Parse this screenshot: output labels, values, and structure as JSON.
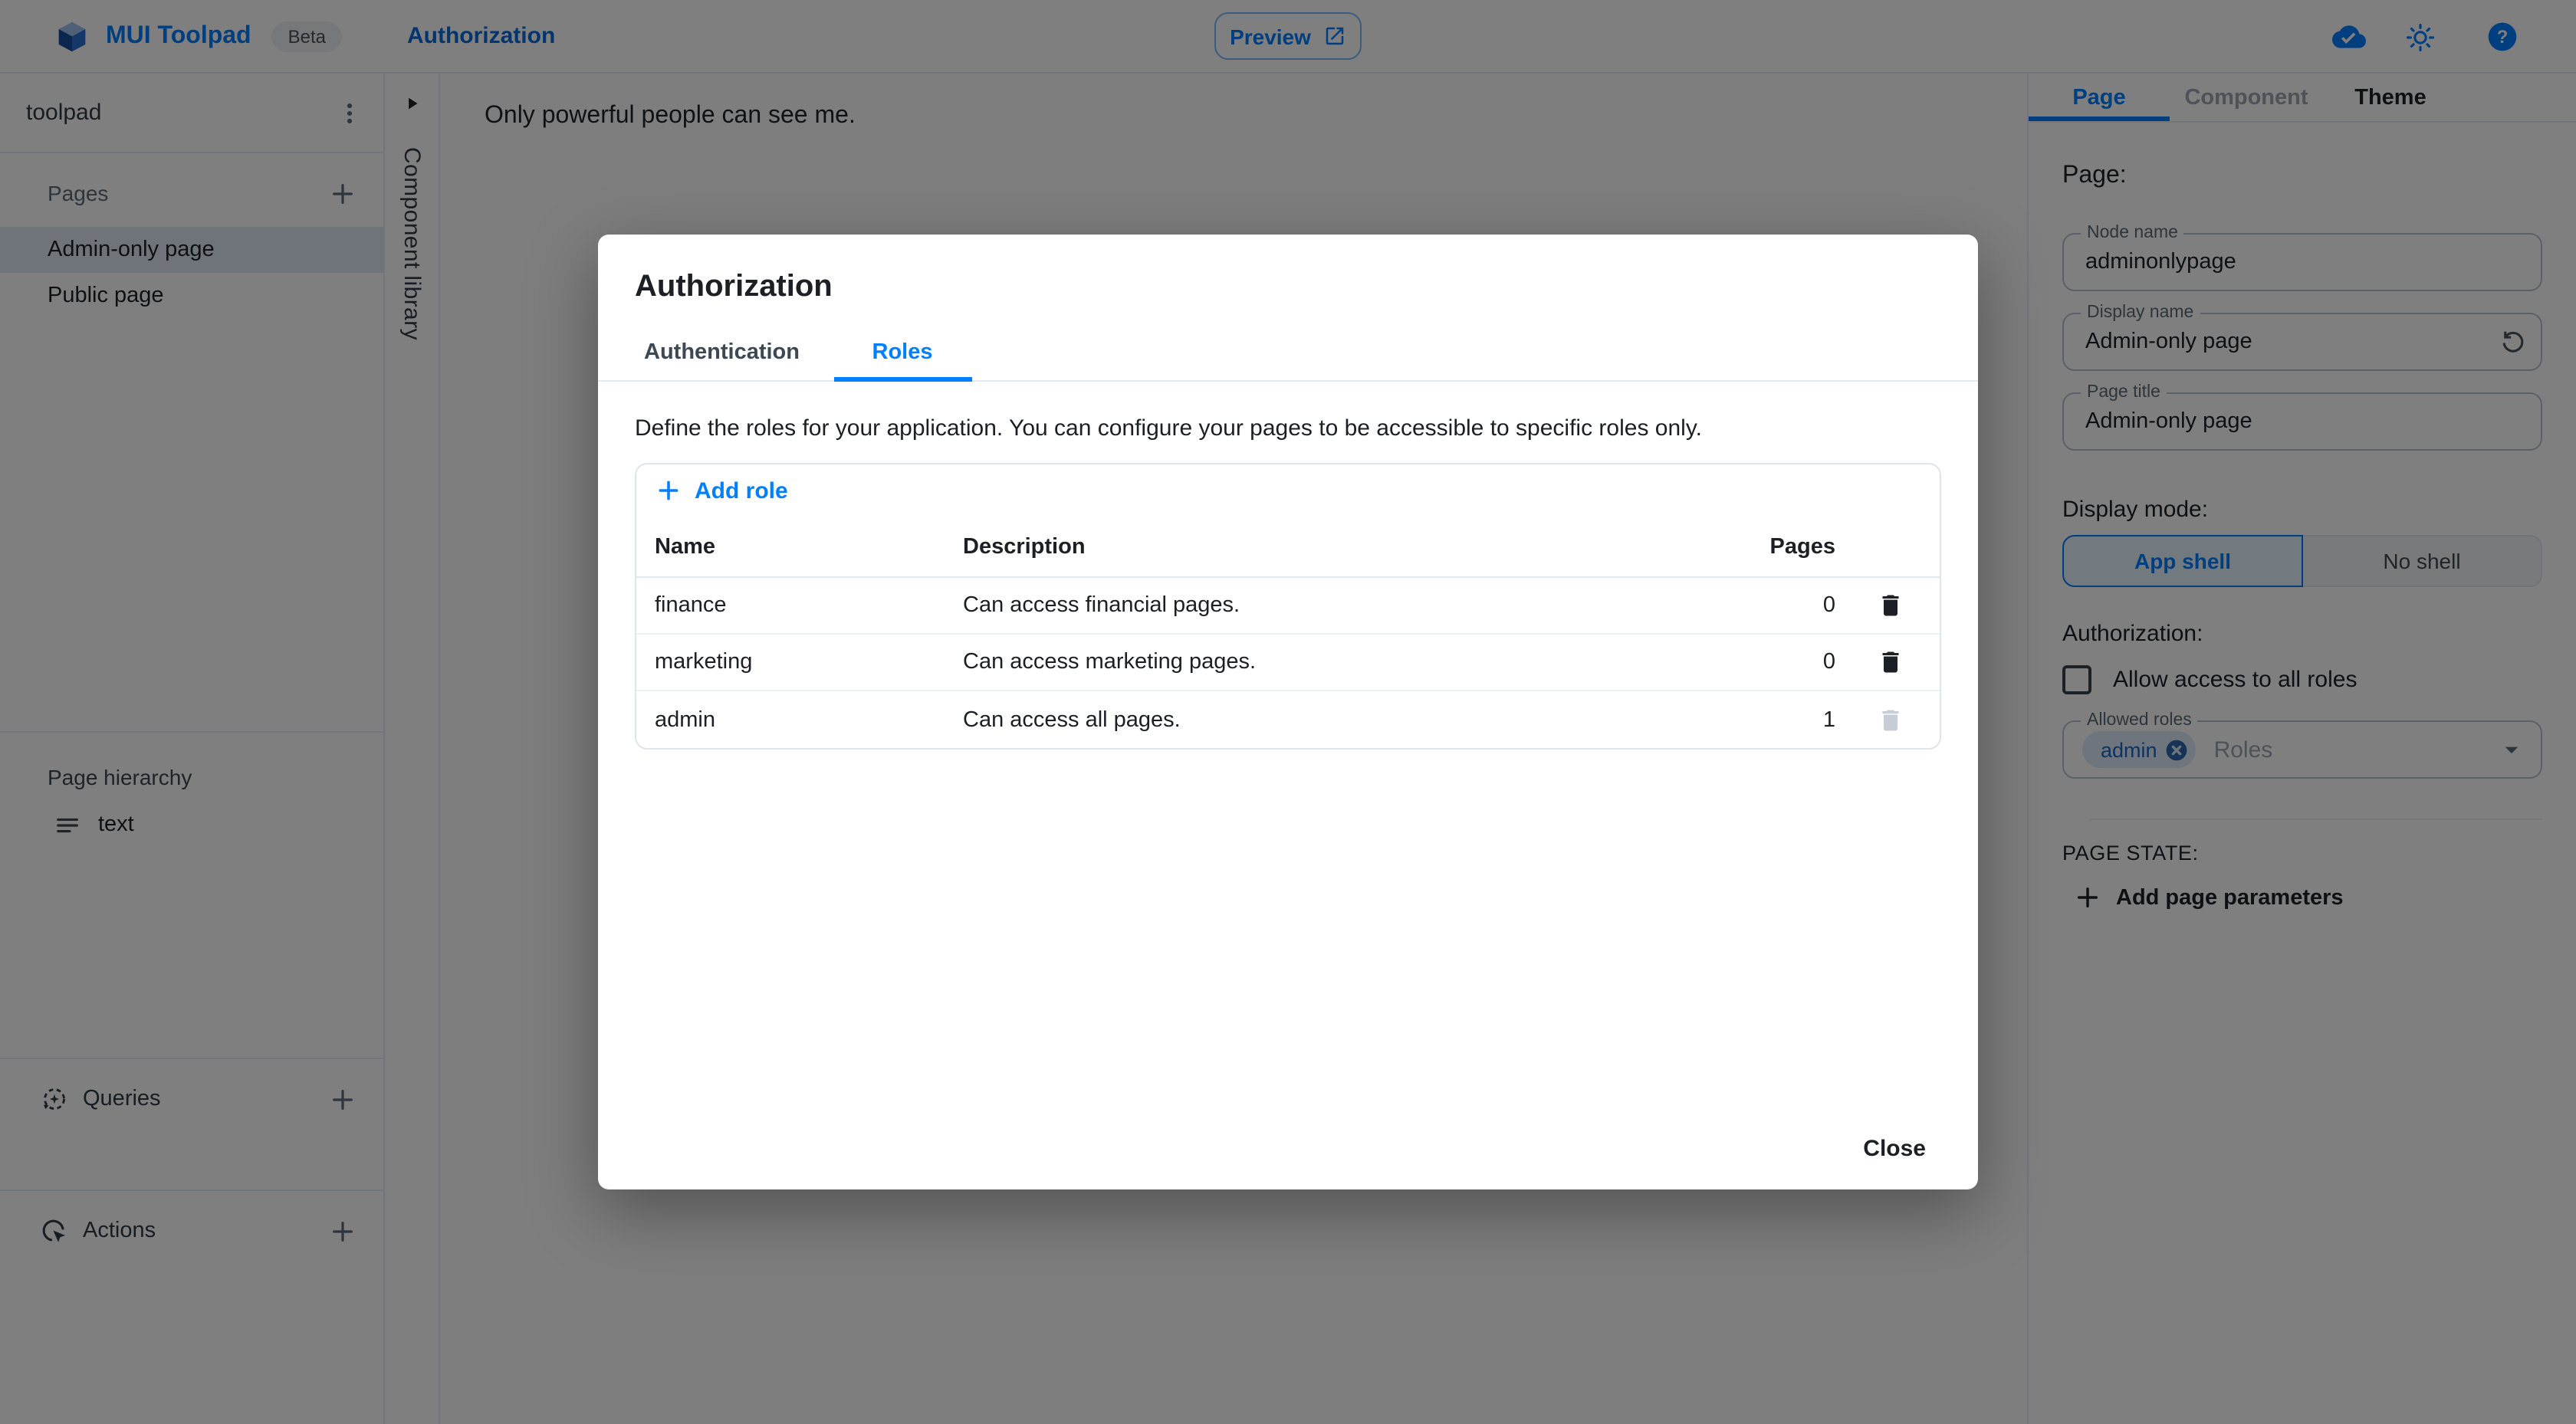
{
  "colors": {
    "accent": "#007FFF",
    "text_primary": "#1C2025",
    "divider": "#E5EAF2",
    "selected_page_bg": "#DEE8F6",
    "chip_bg": "#DCEAFB"
  },
  "header": {
    "app_title": "MUI Toolpad",
    "beta_label": "Beta",
    "nav_link": "Authorization",
    "preview_label": "Preview"
  },
  "sidebar": {
    "project_name": "toolpad",
    "pages_label": "Pages",
    "pages": [
      {
        "label": "Admin-only page",
        "selected": true
      },
      {
        "label": "Public page",
        "selected": false
      }
    ],
    "hierarchy_label": "Page hierarchy",
    "hierarchy_items": [
      {
        "label": "text"
      }
    ],
    "queries_label": "Queries",
    "actions_label": "Actions"
  },
  "component_library": {
    "label": "Component library"
  },
  "canvas": {
    "text": "Only powerful people can see me."
  },
  "dialog": {
    "title": "Authorization",
    "tabs": [
      {
        "label": "Authentication",
        "active": false
      },
      {
        "label": "Roles",
        "active": true
      }
    ],
    "description": "Define the roles for your application. You can configure your pages to be accessible to specific roles only.",
    "add_role_label": "Add role",
    "table": {
      "columns": [
        "Name",
        "Description",
        "Pages"
      ],
      "rows": [
        {
          "name": "finance",
          "description": "Can access financial pages.",
          "pages": "0",
          "deletable": true
        },
        {
          "name": "marketing",
          "description": "Can access marketing pages.",
          "pages": "0",
          "deletable": true
        },
        {
          "name": "admin",
          "description": "Can access all pages.",
          "pages": "1",
          "deletable": false
        }
      ]
    },
    "close_label": "Close"
  },
  "inspector": {
    "tabs": [
      {
        "label": "Page",
        "active": true
      },
      {
        "label": "Component",
        "disabled": true
      },
      {
        "label": "Theme"
      }
    ],
    "section_title": "Page:",
    "node_name": {
      "label": "Node name",
      "value": "adminonlypage"
    },
    "display_name": {
      "label": "Display name",
      "value": "Admin-only page"
    },
    "page_title": {
      "label": "Page title",
      "value": "Admin-only page"
    },
    "display_mode_label": "Display mode:",
    "display_modes": [
      {
        "label": "App shell",
        "selected": true
      },
      {
        "label": "No shell",
        "selected": false
      }
    ],
    "authorization_label": "Authorization:",
    "allow_all_label": "Allow access to all roles",
    "allowed_roles": {
      "label": "Allowed roles",
      "chips": [
        "admin"
      ],
      "placeholder": "Roles"
    },
    "page_state_label": "PAGE STATE:",
    "add_page_parameters_label": "Add page parameters"
  }
}
